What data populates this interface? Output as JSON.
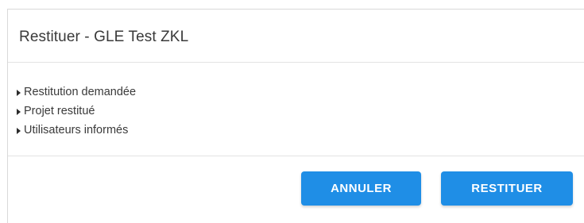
{
  "dialog": {
    "title": "Restituer - GLE Test ZKL",
    "steps": [
      {
        "label": "Restitution demandée",
        "icon": "caret-right-icon"
      },
      {
        "label": "Projet restitué",
        "icon": "caret-right-icon"
      },
      {
        "label": "Utilisateurs informés",
        "icon": "caret-right-icon"
      }
    ],
    "buttons": {
      "cancel_label": "ANNULER",
      "restore_label": "RESTITUER"
    }
  },
  "colors": {
    "accent": "#1f8ee6",
    "text": "#3a3a3a",
    "divider": "#e3e3e3"
  }
}
